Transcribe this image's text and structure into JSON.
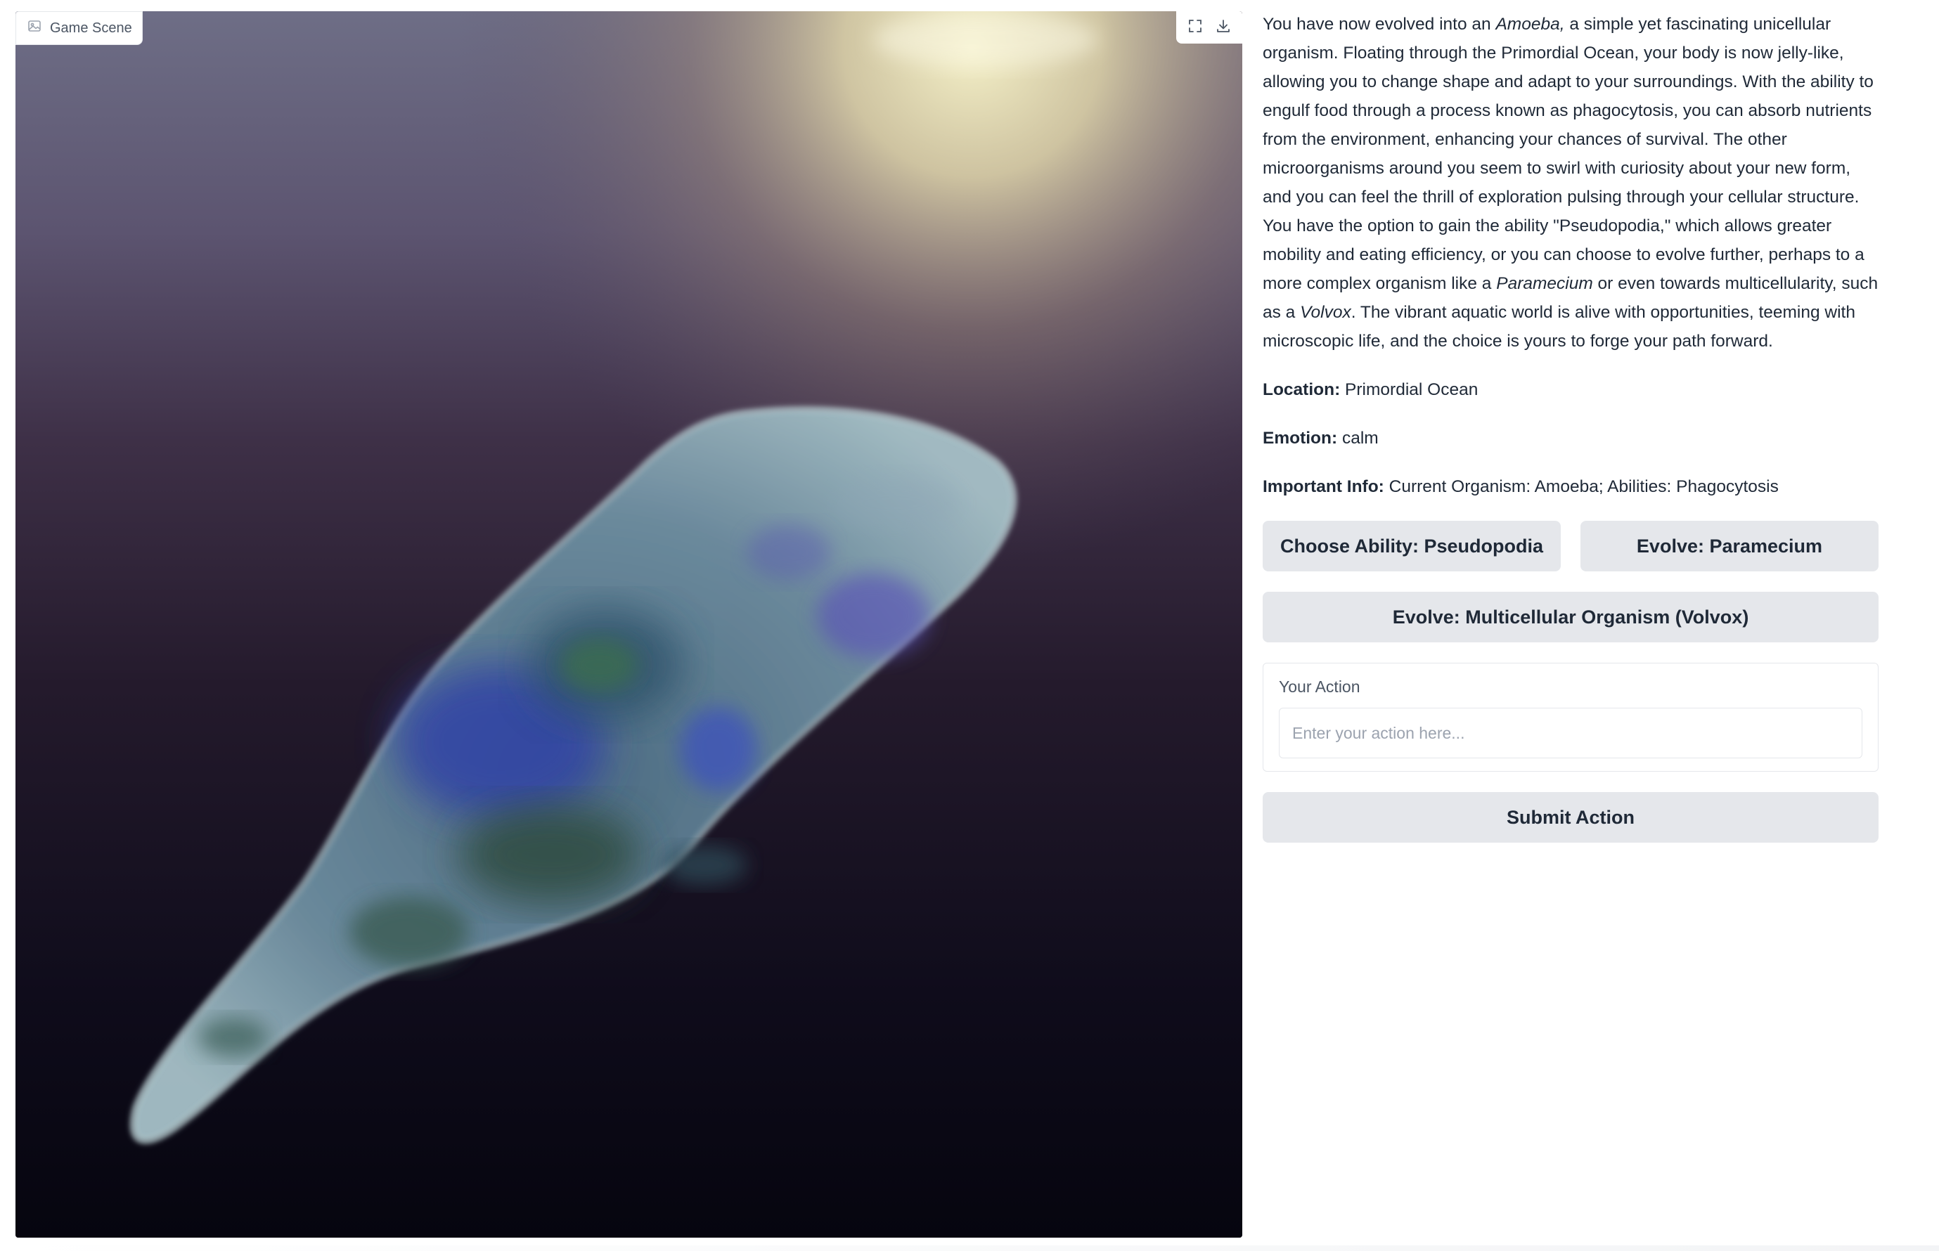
{
  "image": {
    "label": "Game Scene",
    "label_icon": "image-icon",
    "fullscreen_icon": "fullscreen-icon",
    "download_icon": "download-icon",
    "alt": "A translucent blue-green amoeba floating in a dark purple ocean with light from above"
  },
  "story": {
    "s1": "You have now evolved into an ",
    "em1": "Amoeba,",
    "s2": " a simple yet fascinating unicellular organism. Floating through the Primordial Ocean, your body is now jelly-like, allowing you to change shape and adapt to your surroundings. With the ability to engulf food through a process known as phagocytosis, you can absorb nutrients from the environment, enhancing your chances of survival. The other microorganisms around you seem to swirl with curiosity about your new form, and you can feel the thrill of exploration pulsing through your cellular structure. You have the option to gain the ability \"Pseudopodia,\" which allows greater mobility and eating efficiency, or you can choose to evolve further, perhaps to a more complex organism like a ",
    "em2": "Paramecium",
    "s3": " or even towards multicellularity, such as a ",
    "em3": "Volvox",
    "s4": ". The vibrant aquatic world is alive with opportunities, teeming with microscopic life, and the choice is yours to forge your path forward."
  },
  "info": {
    "location_label": "Location:",
    "location_value": " Primordial Ocean",
    "emotion_label": "Emotion:",
    "emotion_value": " calm",
    "important_label": "Important Info:",
    "important_value": " Current Organism: Amoeba; Abilities: Phagocytosis"
  },
  "buttons": {
    "choice1": "Choose Ability: Pseudopodia",
    "choice2": "Evolve: Paramecium",
    "choice3": "Evolve: Multicellular Organism (Volvox)",
    "submit": "Submit Action"
  },
  "action": {
    "label": "Your Action",
    "value": "",
    "placeholder": "Enter your action here..."
  }
}
